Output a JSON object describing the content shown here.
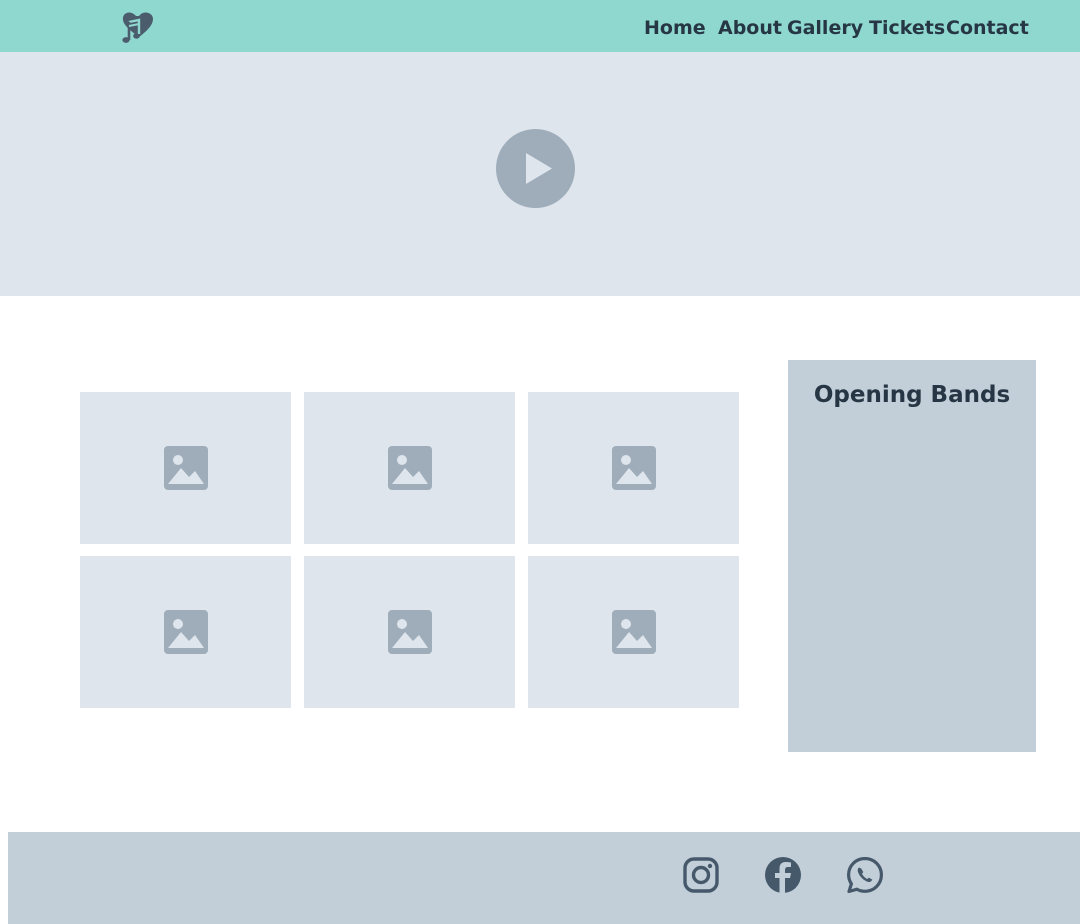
{
  "brand": {
    "logo_icon": "music-heart-icon"
  },
  "nav": {
    "home": "Home",
    "about": "About",
    "gallery": "Gallery",
    "tickets": "Tickets",
    "contact": "Contact"
  },
  "hero": {
    "video_icon": "play-icon"
  },
  "gallery": {
    "tiles": [
      {
        "icon": "image-placeholder-icon"
      },
      {
        "icon": "image-placeholder-icon"
      },
      {
        "icon": "image-placeholder-icon"
      },
      {
        "icon": "image-placeholder-icon"
      },
      {
        "icon": "image-placeholder-icon"
      },
      {
        "icon": "image-placeholder-icon"
      }
    ]
  },
  "sidebar": {
    "title": "Opening Bands"
  },
  "footer": {
    "social": [
      "instagram-icon",
      "facebook-icon",
      "whatsapp-icon"
    ]
  },
  "colors": {
    "header": "#8fd8cf",
    "hero": "#dfe5ed",
    "panel": "#c2cfd9",
    "text": "#263644",
    "icon": "#9eadb9"
  }
}
